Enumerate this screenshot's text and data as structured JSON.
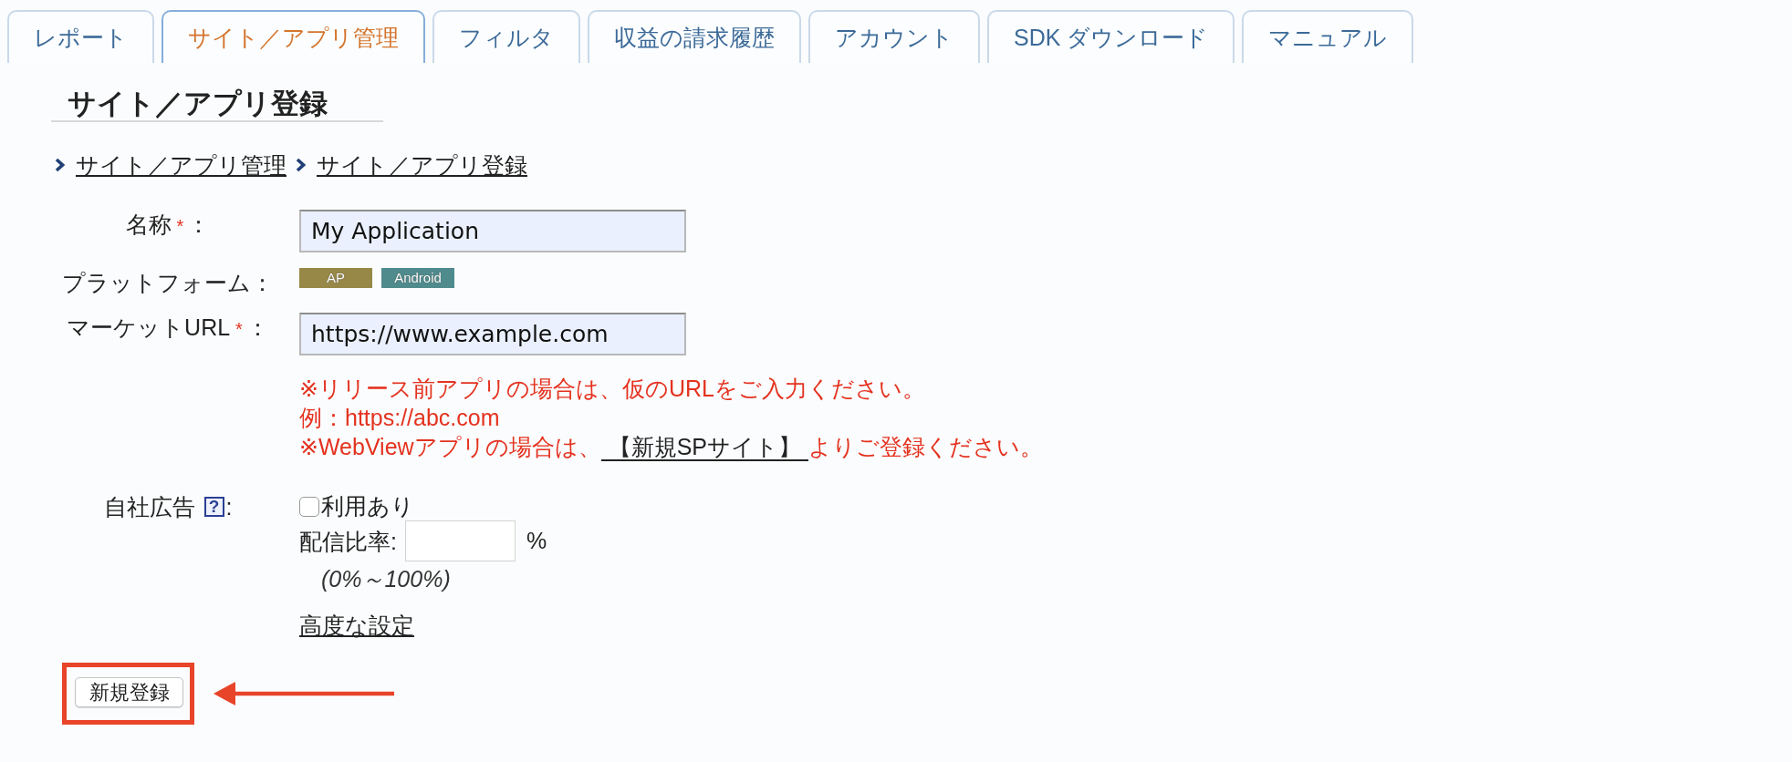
{
  "tabs": [
    {
      "label": "レポート",
      "selected": false
    },
    {
      "label": "サイト／アプリ管理",
      "selected": true
    },
    {
      "label": "フィルタ",
      "selected": false
    },
    {
      "label": "収益の請求履歴",
      "selected": false
    },
    {
      "label": "アカウント",
      "selected": false
    },
    {
      "label": "SDK ダウンロード",
      "selected": false
    },
    {
      "label": "マニュアル",
      "selected": false
    }
  ],
  "page_title": "サイト／アプリ登録",
  "breadcrumb": [
    "サイト／アプリ管理",
    "サイト／アプリ登録"
  ],
  "form": {
    "fields": [
      {
        "kind": "text",
        "label": "名称",
        "required_mark": "*",
        "colon": "：",
        "value": "My Application"
      },
      {
        "kind": "badges",
        "label": "プラットフォーム",
        "colon": "：",
        "badges": [
          {
            "label": "AP",
            "color": "#978848"
          },
          {
            "label": "Android",
            "color": "#4f8b8d"
          }
        ]
      },
      {
        "kind": "text",
        "label": "マーケットURL",
        "required_mark": "*",
        "colon": "：",
        "value": "https://www.example.com",
        "notes": [
          {
            "text": "※リリース前アプリの場合は、仮のURLをご入力ください。"
          },
          {
            "text": "例：https://abc.com"
          },
          {
            "text": "※WebViewアプリの場合は、",
            "link": "【新規SPサイト】",
            "after": "よりご登録ください。"
          }
        ]
      },
      {
        "kind": "own_ads",
        "label": "自社広告",
        "help": "?",
        "colon": ":",
        "checkbox": {
          "label": "利用あり",
          "checked": false
        },
        "rate": {
          "label": "配信比率:",
          "unit": "%",
          "hint": "(0%～100%)"
        },
        "link": "高度な設定"
      }
    ],
    "submit": {
      "label": "新規登録",
      "highlighted": true
    }
  }
}
